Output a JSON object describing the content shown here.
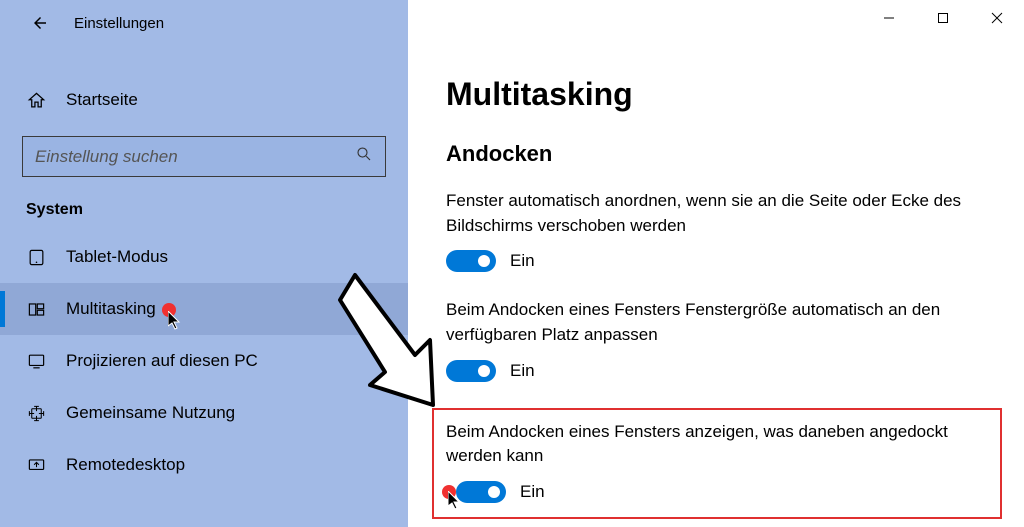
{
  "window": {
    "title": "Einstellungen"
  },
  "sidebar": {
    "home": "Startseite",
    "search_placeholder": "Einstellung suchen",
    "section": "System",
    "items": [
      {
        "label": "Tablet-Modus"
      },
      {
        "label": "Multitasking"
      },
      {
        "label": "Projizieren auf diesen PC"
      },
      {
        "label": "Gemeinsame Nutzung"
      },
      {
        "label": "Remotedesktop"
      }
    ]
  },
  "content": {
    "page_title": "Multitasking",
    "section_title": "Andocken",
    "settings": [
      {
        "desc": "Fenster automatisch anordnen, wenn sie an die Seite oder Ecke des Bildschirms verschoben werden",
        "state": "Ein"
      },
      {
        "desc": "Beim Andocken eines Fensters Fenstergröße automatisch an den verfügbaren Platz anpassen",
        "state": "Ein"
      },
      {
        "desc": "Beim Andocken eines Fensters anzeigen, was daneben angedockt werden kann",
        "state": "Ein"
      }
    ]
  }
}
